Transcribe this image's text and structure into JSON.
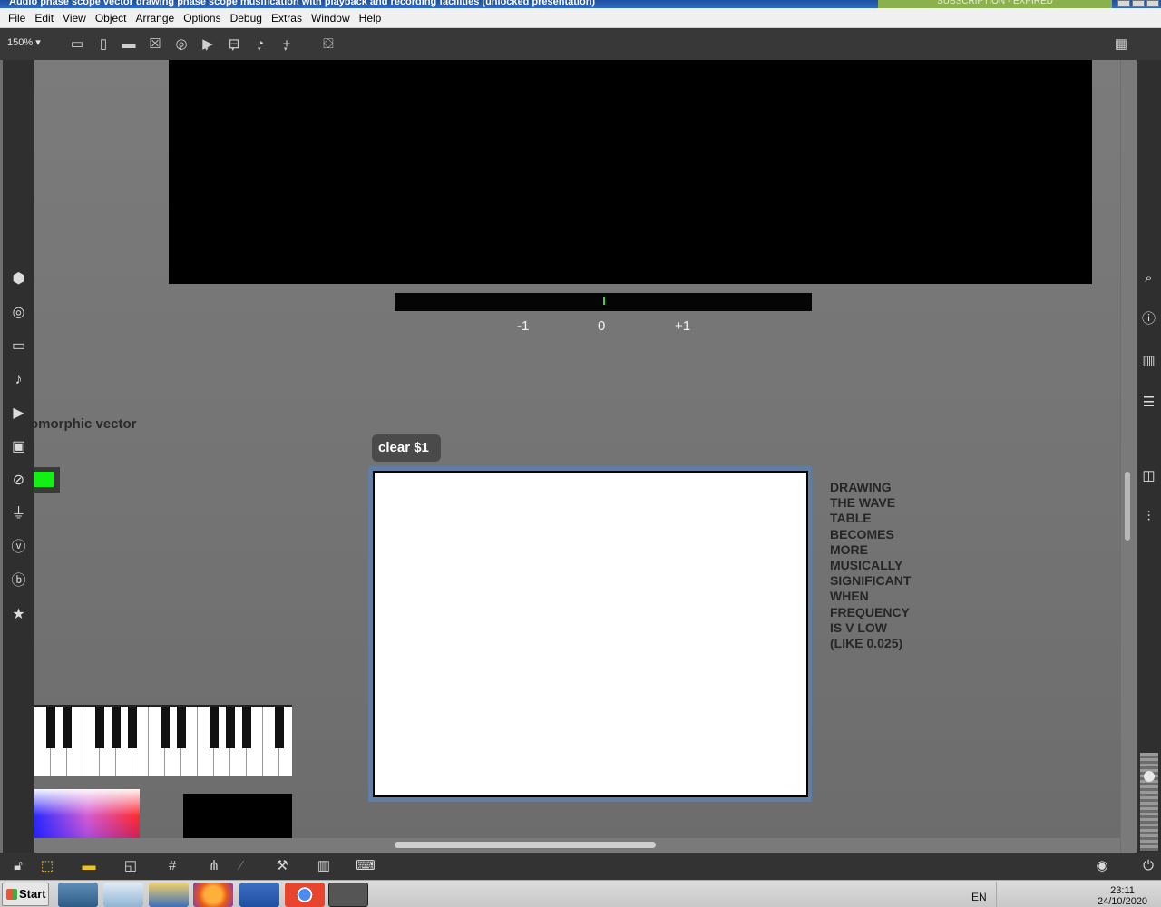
{
  "window": {
    "title": "Audio phase scope vector drawing phase scope musification with playback and recording facilities (unlocked presentation)",
    "subscription": "SUBSCRIPTION - EXPIRED"
  },
  "menu": [
    "File",
    "Edit",
    "View",
    "Object",
    "Arrange",
    "Options",
    "Debug",
    "Extras",
    "Window",
    "Help"
  ],
  "toolbar": {
    "zoom": "150%",
    "zoom_arrow": "▾",
    "icons": [
      "patcher-window-icon",
      "message-box-icon",
      "comment-icon",
      "toggle-x-icon",
      "button-circle-icon",
      "play-icon",
      "slider-icon",
      "dial-icon",
      "add-plus-icon",
      "paint-bucket-icon",
      "grid-view-icon"
    ]
  },
  "meter": {
    "ticks": [
      "-1",
      "0",
      "+1"
    ],
    "level": 0
  },
  "canvas": {
    "partial_label": "omorphic vector",
    "swatch_color": "#12f014",
    "clear_button": "clear $1",
    "note": [
      "DRAWING",
      "THE WAVE",
      "TABLE",
      "BECOMES",
      "MORE",
      "MUSICALLY",
      "SIGNIFICANT",
      "WHEN",
      "FREQUENCY",
      "IS V LOW",
      "(LIKE 0.025)"
    ]
  },
  "left_sidebar": [
    "package-icon",
    "target-icon",
    "video-icon",
    "music-note-icon",
    "media-play-icon",
    "image-icon",
    "paperclip-icon",
    "plugin-icon",
    "vimeo-icon",
    "b-icon",
    "star-icon"
  ],
  "right_sidebar": [
    "search-icon",
    "info-icon",
    "book-icon",
    "list-icon",
    "snapshot-icon",
    "mixer-icon"
  ],
  "bottom_toolbar": [
    "lock-icon",
    "edit-cursor-icon",
    "comment-icon",
    "layers-icon",
    "grid-icon",
    "hierarchy-icon",
    "wand-icon",
    "wrench-icon",
    "piano-icon",
    "keyboard-icon",
    "transport-icon",
    "power-icon"
  ],
  "taskbar": {
    "start": "Start",
    "language": "EN",
    "time": "23:11",
    "date": "24/10/2020"
  }
}
